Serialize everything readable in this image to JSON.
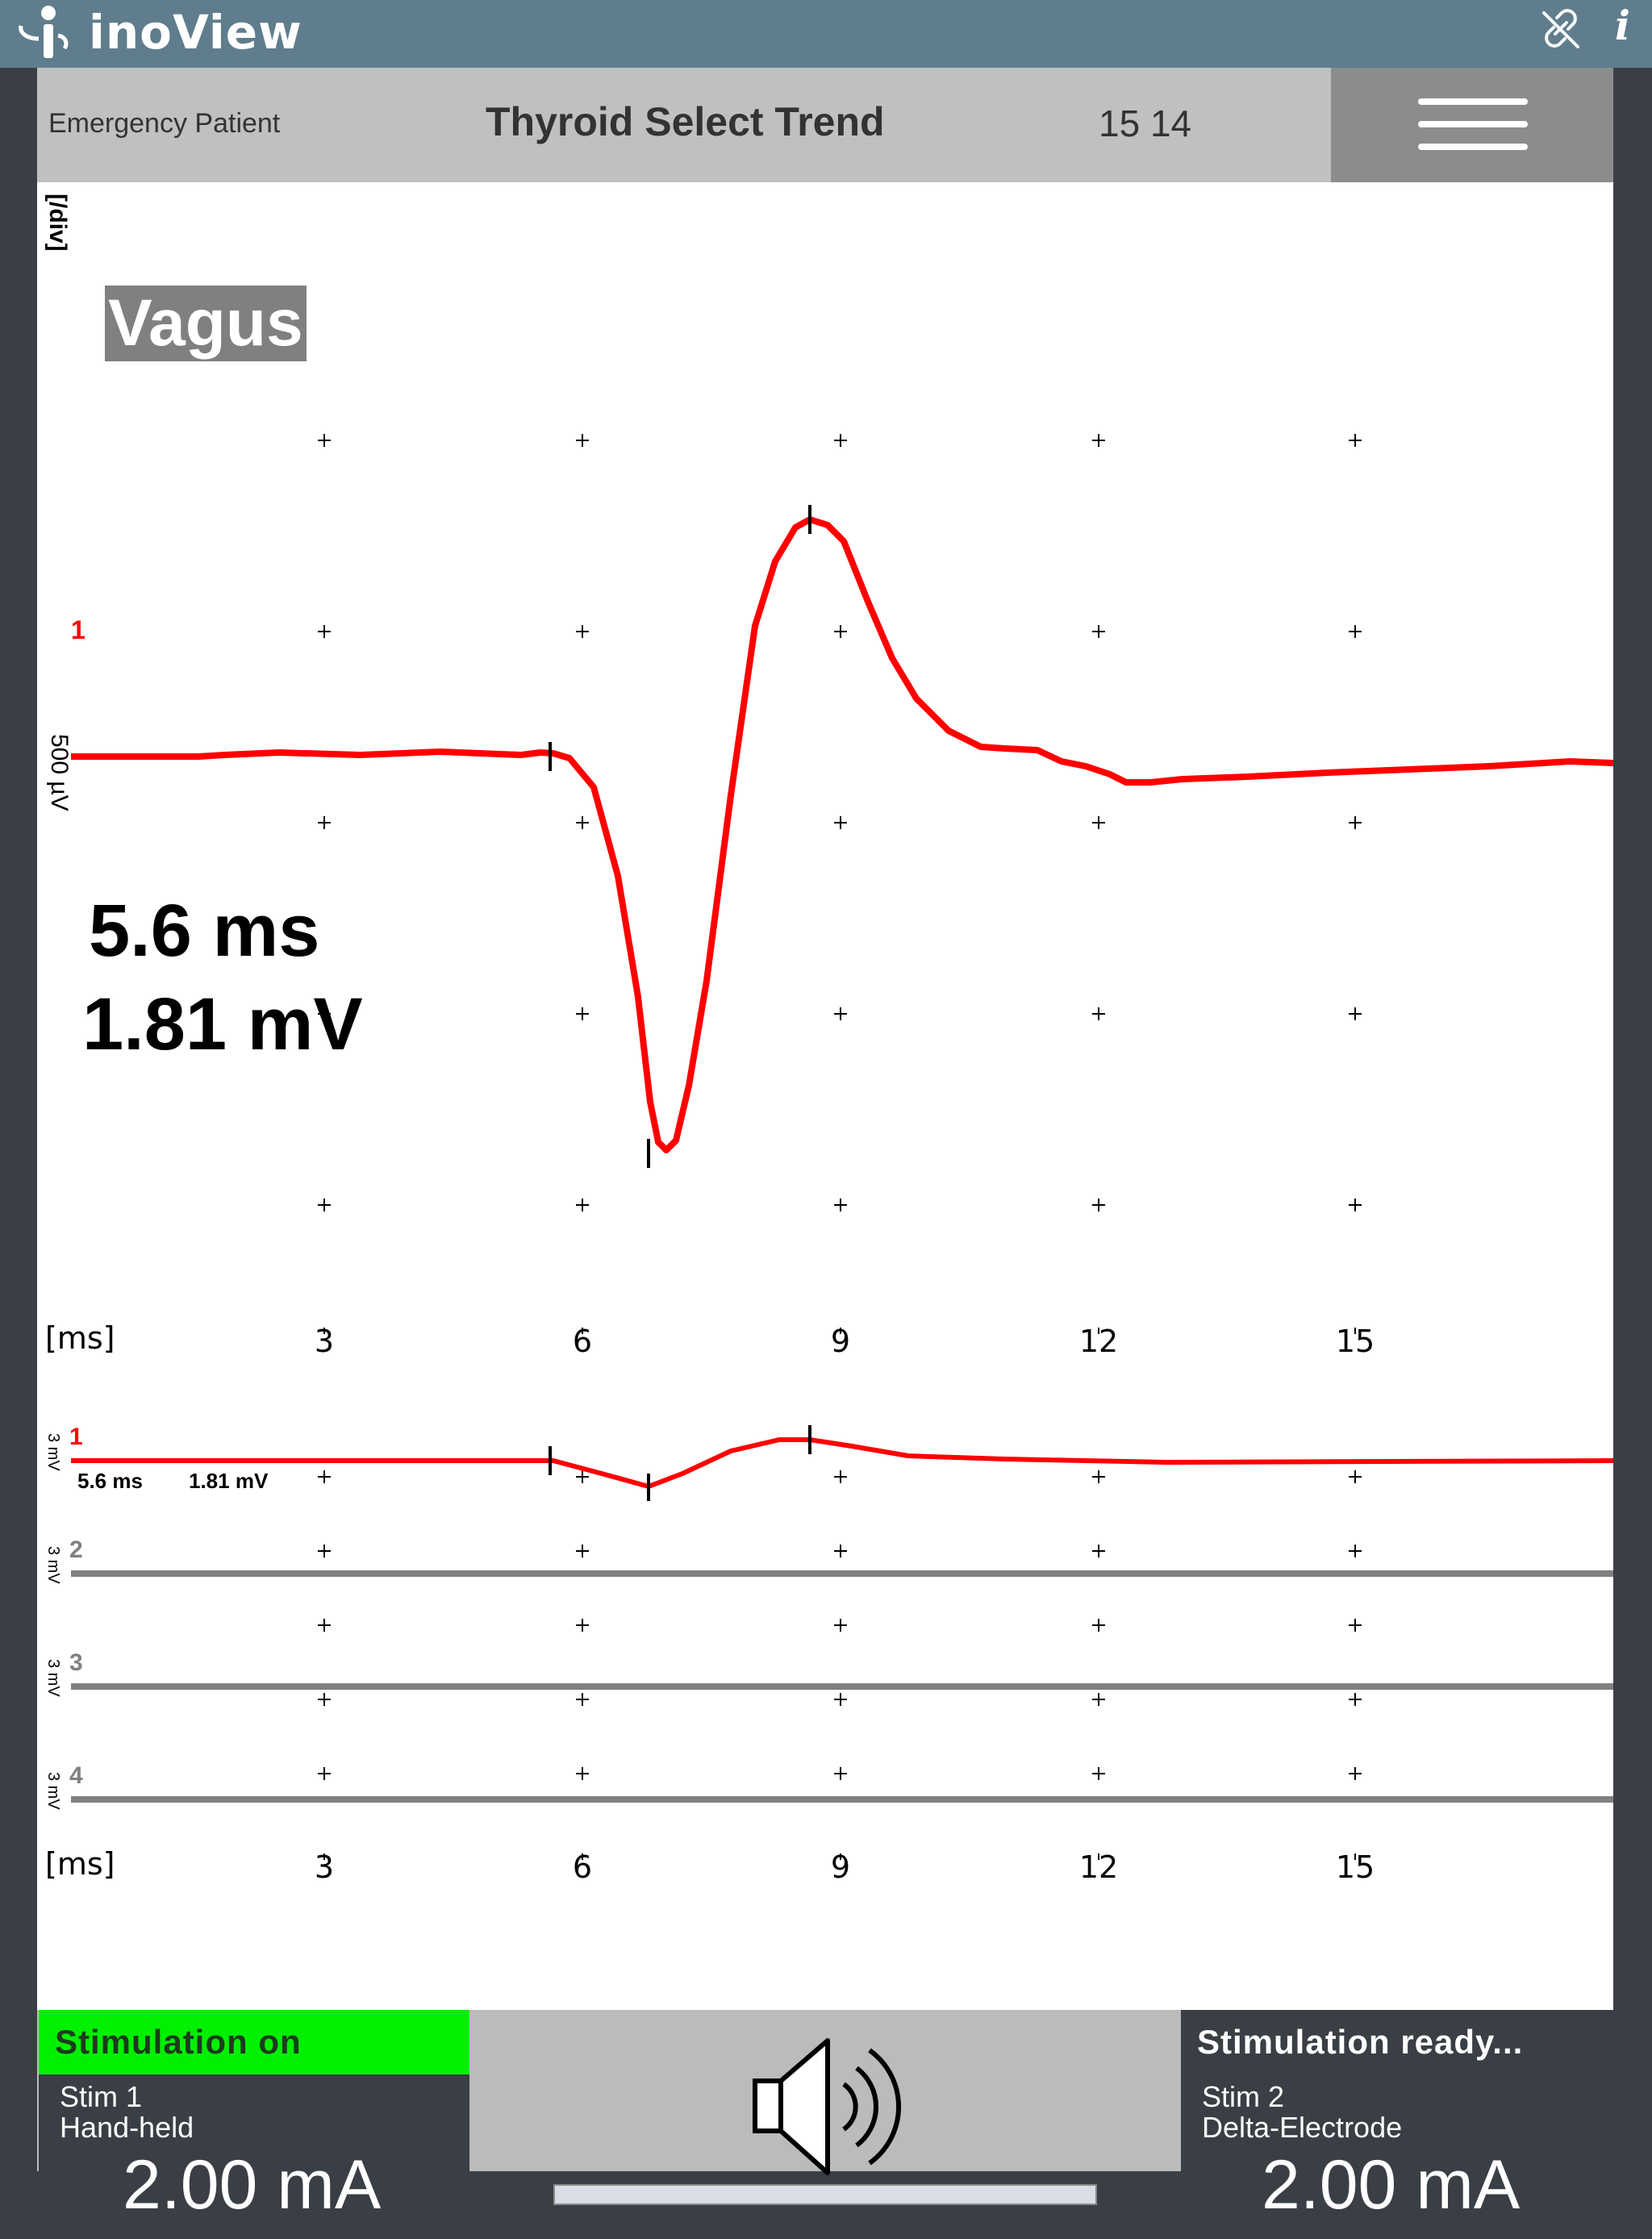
{
  "app": {
    "title": "inoView"
  },
  "header": {
    "patient": "Emergency Patient",
    "test_name": "Thyroid Select Trend",
    "time": "15 14"
  },
  "main_trace": {
    "nerve_label": "Vagus",
    "channel": "1",
    "scale_unit": "[/div]",
    "scale_value": "500 µV",
    "latency": "5.6 ms",
    "amplitude": "1.81 mV",
    "x_unit": "[ms]",
    "x_ticks": [
      "3",
      "6",
      "9",
      "12",
      "15"
    ]
  },
  "trend_channels": [
    {
      "channel": "1",
      "scale": "3 mV",
      "latency": "5.6 ms",
      "amplitude": "1.81 mV",
      "active": true
    },
    {
      "channel": "2",
      "scale": "3 mV",
      "active": false
    },
    {
      "channel": "3",
      "scale": "3 mV",
      "active": false
    },
    {
      "channel": "4",
      "scale": "3 mV",
      "active": false
    }
  ],
  "trend_axis": {
    "x_unit": "[ms]",
    "x_ticks": [
      "3",
      "6",
      "9",
      "12",
      "15"
    ]
  },
  "stim1": {
    "status": "Stimulation on",
    "name": "Stim 1",
    "electrode": "Hand-held",
    "current": "2.00 mA",
    "status_color": "#00f000"
  },
  "stim2": {
    "status": "Stimulation ready...",
    "name": "Stim 2",
    "electrode": "Delta-Electrode",
    "current": "2.00 mA"
  },
  "colors": {
    "titlebar": "#5f7d8c",
    "trace_active": "#ff0000",
    "trace_inactive": "#808080",
    "stim_panel": "#3a3e45"
  },
  "icons": [
    "inomed-logo-icon",
    "link-off-icon",
    "info-icon",
    "menu-icon",
    "speaker-icon"
  ]
}
